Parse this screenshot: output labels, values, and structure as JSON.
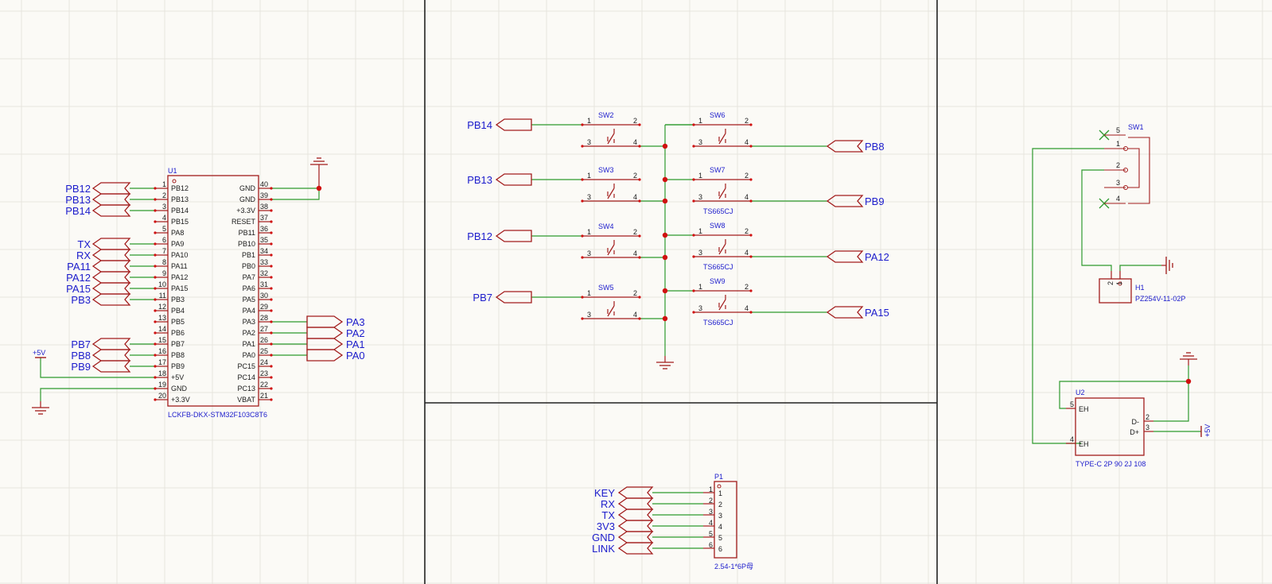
{
  "colors": {
    "background": "#fbfaf6",
    "grid": "#e7e5de",
    "wire": "#2e9a2e",
    "component": "#a21c1c",
    "junction": "#d01010",
    "text_blue": "#1c1ccc",
    "border": "#222222"
  },
  "u1": {
    "ref": "U1",
    "value": "LCKFB-DKX-STM32F103C8T6",
    "left_pins": [
      {
        "num": "1",
        "name": "PB12"
      },
      {
        "num": "2",
        "name": "PB13"
      },
      {
        "num": "3",
        "name": "PB14"
      },
      {
        "num": "4",
        "name": "PB15"
      },
      {
        "num": "5",
        "name": "PA8"
      },
      {
        "num": "6",
        "name": "PA9"
      },
      {
        "num": "7",
        "name": "PA10"
      },
      {
        "num": "8",
        "name": "PA11"
      },
      {
        "num": "9",
        "name": "PA12"
      },
      {
        "num": "10",
        "name": "PA15"
      },
      {
        "num": "11",
        "name": "PB3"
      },
      {
        "num": "12",
        "name": "PB4"
      },
      {
        "num": "13",
        "name": "PB5"
      },
      {
        "num": "14",
        "name": "PB6"
      },
      {
        "num": "15",
        "name": "PB7"
      },
      {
        "num": "16",
        "name": "PB8"
      },
      {
        "num": "17",
        "name": "PB9"
      },
      {
        "num": "18",
        "name": "+5V"
      },
      {
        "num": "19",
        "name": "GND"
      },
      {
        "num": "20",
        "name": "+3.3V"
      }
    ],
    "right_pins": [
      {
        "num": "40",
        "name": "GND"
      },
      {
        "num": "39",
        "name": "GND"
      },
      {
        "num": "38",
        "name": "+3.3V"
      },
      {
        "num": "37",
        "name": "RESET"
      },
      {
        "num": "36",
        "name": "PB11"
      },
      {
        "num": "35",
        "name": "PB10"
      },
      {
        "num": "34",
        "name": "PB1"
      },
      {
        "num": "33",
        "name": "PB0"
      },
      {
        "num": "32",
        "name": "PA7"
      },
      {
        "num": "31",
        "name": "PA6"
      },
      {
        "num": "30",
        "name": "PA5"
      },
      {
        "num": "29",
        "name": "PA4"
      },
      {
        "num": "28",
        "name": "PA3"
      },
      {
        "num": "27",
        "name": "PA2"
      },
      {
        "num": "26",
        "name": "PA1"
      },
      {
        "num": "25",
        "name": "PA0"
      },
      {
        "num": "24",
        "name": "PC15"
      },
      {
        "num": "23",
        "name": "PC14"
      },
      {
        "num": "22",
        "name": "PC13"
      },
      {
        "num": "21",
        "name": "VBAT"
      }
    ],
    "left_netlabels": [
      "PB12",
      "PB13",
      "PB14",
      "TX",
      "RX",
      "PA11",
      "PA12",
      "PA15",
      "PB3",
      "PB7",
      "PB8",
      "PB9"
    ],
    "right_netlabels": [
      "PA3",
      "PA2",
      "PA1",
      "PA0"
    ],
    "power_label": "+5V"
  },
  "switches": {
    "left": [
      {
        "ref": "SW2",
        "net": "PB14"
      },
      {
        "ref": "SW3",
        "net": "PB13"
      },
      {
        "ref": "SW4",
        "net": "PB12"
      },
      {
        "ref": "SW5",
        "net": "PB7"
      }
    ],
    "right": [
      {
        "ref": "SW6",
        "net": "PB8",
        "value": ""
      },
      {
        "ref": "SW7",
        "net": "PB9",
        "value": "TS665CJ"
      },
      {
        "ref": "SW8",
        "net": "PA12",
        "value": "TS665CJ"
      },
      {
        "ref": "SW9",
        "net": "PA15",
        "value": "TS665CJ"
      }
    ],
    "pin_numbers": [
      "1",
      "2",
      "3",
      "4"
    ]
  },
  "p1": {
    "ref": "P1",
    "value": "2.54-1*6P母",
    "nets": [
      "KEY",
      "RX",
      "TX",
      "3V3",
      "GND",
      "LINK"
    ],
    "pins": [
      "1",
      "2",
      "3",
      "4",
      "5",
      "6"
    ]
  },
  "sw1": {
    "ref": "SW1",
    "pins": [
      "5",
      "1",
      "2",
      "3",
      "4"
    ]
  },
  "h1": {
    "ref": "H1",
    "value": "PZ254V-11-02P",
    "pins": [
      "2",
      "1"
    ]
  },
  "u2": {
    "ref": "U2",
    "value": "TYPE-C 2P 90 2J 108",
    "left_pins": [
      {
        "num": "5",
        "name": "EH"
      },
      {
        "num": "4",
        "name": "EH"
      }
    ],
    "right_pins": [
      {
        "num": "2",
        "name": "D-"
      },
      {
        "num": "3",
        "name": "D+"
      }
    ],
    "power_label": "+5V"
  }
}
